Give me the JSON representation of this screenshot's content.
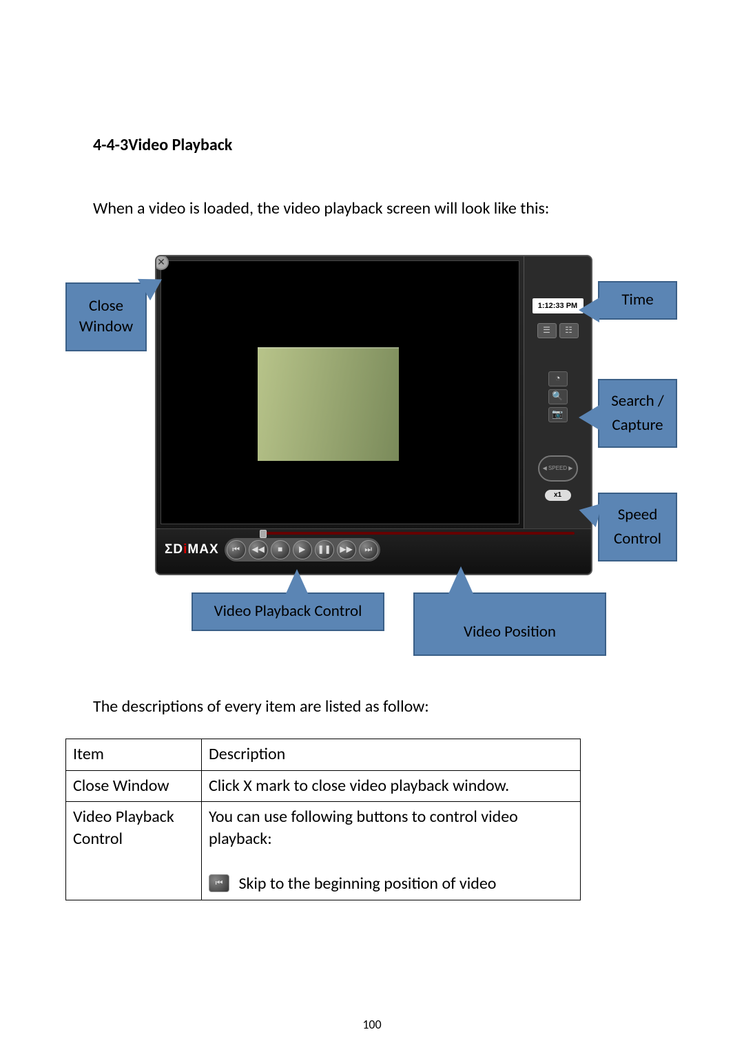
{
  "heading": "4-4-3Video Playback",
  "intro": "When a video is loaded, the video playback screen will look like this:",
  "player": {
    "time": "1:12:33 PM",
    "speed_label": "x1",
    "logo_parts": {
      "a": "ΣD",
      "i": "i",
      "b": "MAX"
    }
  },
  "callouts": {
    "close": "Close Window",
    "time": "Time",
    "search": "Search / Capture",
    "speed": "Speed Control",
    "vpc": "Video Playback Control",
    "vpos": "Video Position"
  },
  "desc_intro": "The descriptions of every item are listed as follow:",
  "table": {
    "header_item": "Item",
    "header_desc": "Description",
    "rows": [
      {
        "item": "Close Window",
        "desc": "Click X mark to close video playback window."
      },
      {
        "item": "Video Playback Control",
        "desc": "You can use following buttons to control video playback:",
        "skip_label": "Skip to the beginning position of video"
      }
    ]
  },
  "page_number": "100"
}
